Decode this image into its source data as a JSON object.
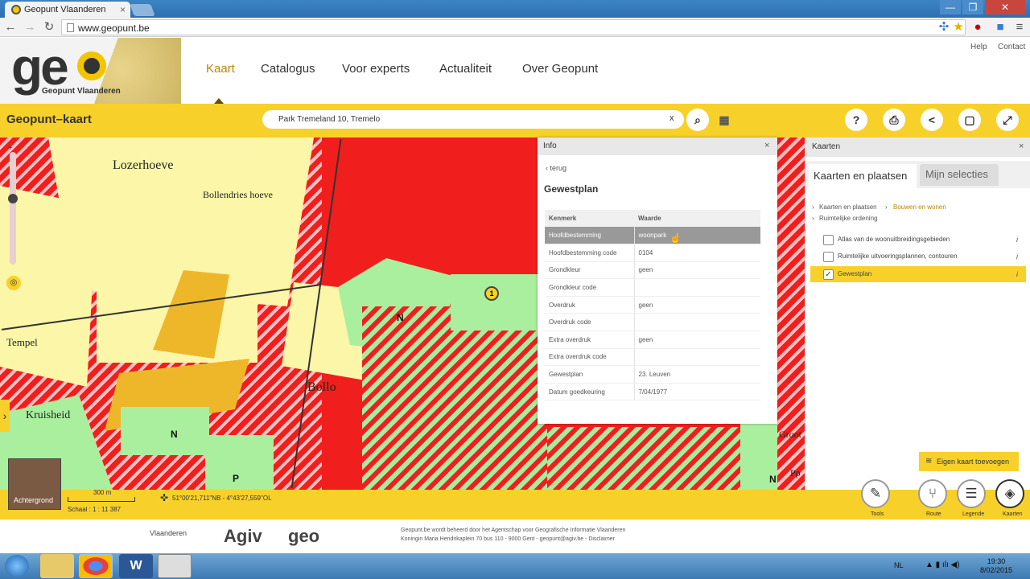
{
  "browser": {
    "tab_title": "Geopunt Vlaanderen",
    "tab_close": "×",
    "url": "www.geopunt.be",
    "window_controls": [
      "—",
      "❐",
      "✕"
    ]
  },
  "site": {
    "logo_text": "ge",
    "logo_sub": "Geopunt Vlaanderen",
    "nav": [
      "Kaart",
      "Catalogus",
      "Voor experts",
      "Actualiteit",
      "Over Geopunt"
    ],
    "top_links": [
      "Help",
      "Contact"
    ]
  },
  "toolbar": {
    "title": "Geopunt–kaart",
    "search_value": "Park Tremeland 10, Tremelo",
    "search_clear": "x",
    "buttons": [
      "?",
      "⎙",
      "<",
      "▢",
      "⤢"
    ]
  },
  "map": {
    "labels": [
      "Lozerhoeve",
      "Bollendries hoeve",
      "Tempel",
      "Bollo",
      "Kruisheid",
      "Groot",
      "Pp"
    ],
    "n_marker": "N",
    "p_marker": "P",
    "background_label": "Achtergrond",
    "scale_length": "300 m",
    "scale_text": "Schaal : 1 : 11 387",
    "coordinates": "51°00'21,711\"NB - 4°43'27,559\"OL",
    "marker_number": "1",
    "side_toggle": "›"
  },
  "info_panel": {
    "header": "Info",
    "close": "×",
    "back": "‹  terug",
    "title": "Gewestplan",
    "columns": [
      "Kenmerk",
      "Waarde"
    ],
    "rows": [
      [
        "Hoofdbestemming",
        "woonpark"
      ],
      [
        "Hoofdbestemming code",
        "0104"
      ],
      [
        "Grondkleur",
        "geen"
      ],
      [
        "Grondkleur code",
        ""
      ],
      [
        "Overdruk",
        "geen"
      ],
      [
        "Overdruk code",
        ""
      ],
      [
        "Extra overdruk",
        "geen"
      ],
      [
        "Extra overdruk code",
        ""
      ],
      [
        "Gewestplan",
        "23. Leuven"
      ],
      [
        "Datum goedkeuring",
        "7/04/1977"
      ]
    ]
  },
  "kaarten_panel": {
    "header": "Kaarten",
    "close": "×",
    "tabs": [
      "Kaarten en plaatsen",
      "Mijn selecties"
    ],
    "breadcrumb": [
      "Kaarten en plaatsen",
      "Bouwen en wonen",
      "Ruimtelijke ordening"
    ],
    "items": [
      {
        "label": "Atlas van de woonuitbreidingsgebieden",
        "checked": false
      },
      {
        "label": "Ruimtelijke uitvoeringsplannen, contouren",
        "checked": false
      },
      {
        "label": "Gewestplan",
        "checked": true
      }
    ],
    "info_icon": "i",
    "add_button": "Eigen kaart toevoegen"
  },
  "bottom_buttons": [
    {
      "label": "Tools",
      "icon": "wrench-icon"
    },
    {
      "label": "Route",
      "icon": "route-icon"
    },
    {
      "label": "Legende",
      "icon": "list-icon"
    },
    {
      "label": "Kaarten",
      "icon": "layers-icon"
    }
  ],
  "footer": {
    "line1": "Geopunt.be wordt beheerd door het Agentschap voor Geografische Informatie Vlaanderen",
    "line2": "Koningin Maria Hendrikaplein 70 bus 110 - 9000 Gent - geopunt@agiv.be - Disclaimer",
    "logo1": "Vlaanderen",
    "logo2": "Agiv",
    "logo3": "geo"
  },
  "taskbar": {
    "language": "NL",
    "time": "19:30",
    "date": "8/02/2015"
  },
  "colors": {
    "accent_yellow": "#f7d12a",
    "zone_red": "#f11e1e",
    "zone_yellow": "#fbf6a8",
    "zone_green": "#a9ef9e"
  }
}
